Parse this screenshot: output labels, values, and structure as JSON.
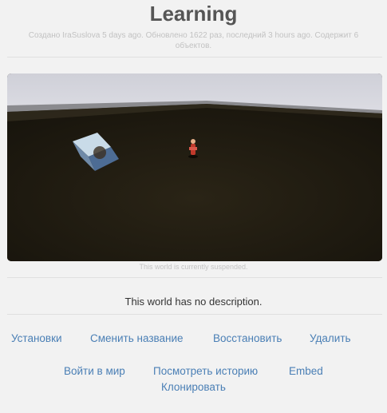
{
  "world": {
    "title": "Learning",
    "meta": "Создано IraSuslova 5 days ago. Обновлено 1622 раз, последний 3 hours ago. Содержит 6 объектов.",
    "suspended_note": "This world is currently suspended.",
    "description": "This world has no description."
  },
  "actions": {
    "settings": "Установки",
    "rename": "Сменить название",
    "restore": "Восстановить",
    "delete": "Удалить",
    "enter": "Войти в мир",
    "history": "Посмотреть историю",
    "embed": "Embed",
    "clone": "Клонировать"
  },
  "colors": {
    "link": "#4a7fb5",
    "sky": "#d4d4dc",
    "ground": "#231d12"
  }
}
